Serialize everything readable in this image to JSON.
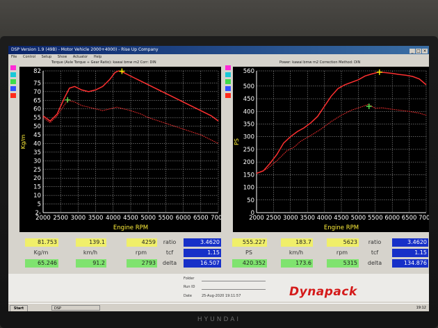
{
  "window": {
    "title": "DSP Version 1.9 (49B) - Motor Vehicle 2000+4000) - Rise Up Company",
    "menu": [
      "File",
      "Control",
      "Setup",
      "Show",
      "Actuator",
      "Help"
    ]
  },
  "brand": "HYUNDAI",
  "series_colors": [
    "#ff3030",
    "#f5f000",
    "#59e050"
  ],
  "chip_colors": [
    "#ff2bd6",
    "#18c8d8",
    "#3edc4a",
    "#3050ff",
    "#ff2a1a"
  ],
  "chart_data": [
    {
      "type": "line",
      "title": "Torque (Axle Torque ÷ Gear Ratio): kawai bmw m2     Corr: DIN",
      "xlabel": "Engine RPM",
      "ylabel": "Kg/m",
      "xlim": [
        2000,
        7000
      ],
      "ylim": [
        0,
        82
      ],
      "x_ticks": [
        2000,
        2500,
        3000,
        3500,
        4000,
        4500,
        5000,
        5500,
        6000,
        6500,
        7000
      ],
      "y_ticks": [
        0,
        5,
        10,
        15,
        20,
        25,
        30,
        35,
        40,
        45,
        50,
        55,
        60,
        65,
        70,
        75,
        82
      ],
      "y_tick_labels": [
        "2-",
        "5",
        "10",
        "15",
        "20",
        "25",
        "30",
        "35",
        "40",
        "45",
        "50",
        "55",
        "60",
        "65",
        "70",
        "75",
        "82"
      ],
      "grid": true,
      "series": [
        {
          "style": "solid",
          "x": [
            2000,
            2200,
            2400,
            2600,
            2750,
            2900,
            3100,
            3300,
            3500,
            3700,
            3900,
            4050,
            4150,
            4250,
            4400,
            4600,
            4800,
            5000,
            5200,
            5400,
            5600,
            5800,
            6000,
            6200,
            6400,
            6600,
            6800,
            7000
          ],
          "y": [
            56,
            53,
            57,
            66,
            72,
            73,
            71,
            70,
            71,
            73,
            77,
            81,
            82,
            81.5,
            80,
            78,
            76,
            74,
            72,
            70,
            68,
            66,
            64,
            62,
            60,
            58,
            56,
            53
          ]
        },
        {
          "style": "dotted",
          "x": [
            2000,
            2200,
            2400,
            2600,
            2700,
            2900,
            3100,
            3300,
            3500,
            3700,
            3900,
            4100,
            4300,
            4500,
            4800,
            5000,
            5300,
            5600,
            5900,
            6200,
            6500,
            6800,
            7000
          ],
          "y": [
            55,
            52,
            56,
            62,
            65,
            64,
            62,
            61,
            60,
            59,
            60,
            61,
            60,
            59,
            57,
            55,
            53,
            51,
            49,
            47,
            45,
            42,
            40
          ]
        }
      ],
      "markers": [
        {
          "x": 4250,
          "y": 81.8,
          "color": "yellow"
        },
        {
          "x": 2700,
          "y": 65.2,
          "color": "green"
        }
      ]
    },
    {
      "type": "line",
      "title": "Power: kawai bmw m2     Correction Method: DIN",
      "xlabel": "Engine RPM",
      "ylabel": "PS",
      "xlim": [
        2000,
        7000
      ],
      "ylim": [
        0,
        560
      ],
      "x_ticks": [
        2000,
        2500,
        3000,
        3500,
        4000,
        4500,
        5000,
        5500,
        6000,
        6500,
        7000
      ],
      "y_ticks": [
        0,
        50,
        100,
        150,
        200,
        250,
        300,
        350,
        400,
        450,
        500,
        560
      ],
      "y_tick_labels": [
        "0",
        "50",
        "100",
        "150",
        "200",
        "250",
        "300",
        "350",
        "400",
        "450",
        "500",
        "560"
      ],
      "grid": true,
      "series": [
        {
          "style": "solid",
          "x": [
            2000,
            2200,
            2400,
            2600,
            2800,
            3000,
            3200,
            3400,
            3600,
            3800,
            4000,
            4200,
            4400,
            4600,
            4800,
            5000,
            5200,
            5400,
            5600,
            5800,
            6000,
            6200,
            6400,
            6600,
            6800,
            7000
          ],
          "y": [
            155,
            165,
            195,
            230,
            275,
            300,
            320,
            335,
            355,
            380,
            420,
            460,
            490,
            505,
            515,
            525,
            540,
            548,
            555,
            553,
            550,
            546,
            543,
            538,
            528,
            505
          ]
        },
        {
          "style": "dotted",
          "x": [
            2000,
            2300,
            2600,
            2900,
            3100,
            3300,
            3600,
            3900,
            4200,
            4500,
            4800,
            5100,
            5300,
            5500,
            5700,
            5900,
            6200,
            6500,
            6800,
            7000
          ],
          "y": [
            155,
            172,
            205,
            245,
            258,
            282,
            305,
            330,
            360,
            385,
            405,
            418,
            428,
            412,
            414,
            410,
            405,
            400,
            393,
            385
          ]
        }
      ],
      "markers": [
        {
          "x": 5623,
          "y": 555,
          "color": "yellow"
        },
        {
          "x": 5315,
          "y": 420,
          "color": "green"
        }
      ]
    }
  ],
  "readouts": {
    "left": {
      "peak": {
        "value": "81.753",
        "speed": "139.1",
        "rpm": "4259"
      },
      "units": {
        "value": "Kg/m",
        "speed": "km/h",
        "rpm": "rpm"
      },
      "low": {
        "value": "65.246",
        "speed": "91.2",
        "rpm": "2793"
      },
      "ratio_label": "ratio",
      "ratio": "3.4620",
      "tcf_label": "tcf",
      "tcf": "1.15",
      "delta_label": "delta",
      "delta": "16.507"
    },
    "right": {
      "peak": {
        "value": "555.227",
        "speed": "183.7",
        "rpm": "5623"
      },
      "units": {
        "value": "PS",
        "speed": "km/h",
        "rpm": "rpm"
      },
      "low": {
        "value": "420.352",
        "speed": "173.6",
        "rpm": "5315"
      },
      "ratio_label": "ratio",
      "ratio": "3.4620",
      "tcf_label": "tcf",
      "tcf": "1.15",
      "delta_label": "delta",
      "delta": "134.876"
    }
  },
  "footer": {
    "folder_label": "Folder",
    "run_label": "Run ID",
    "date_label": "Date",
    "date_value": "25-Aug-2020 19:11:57",
    "logo": "Dynapack"
  },
  "taskbar": {
    "start": "Start",
    "task": "DSP",
    "clock": "19:12"
  }
}
